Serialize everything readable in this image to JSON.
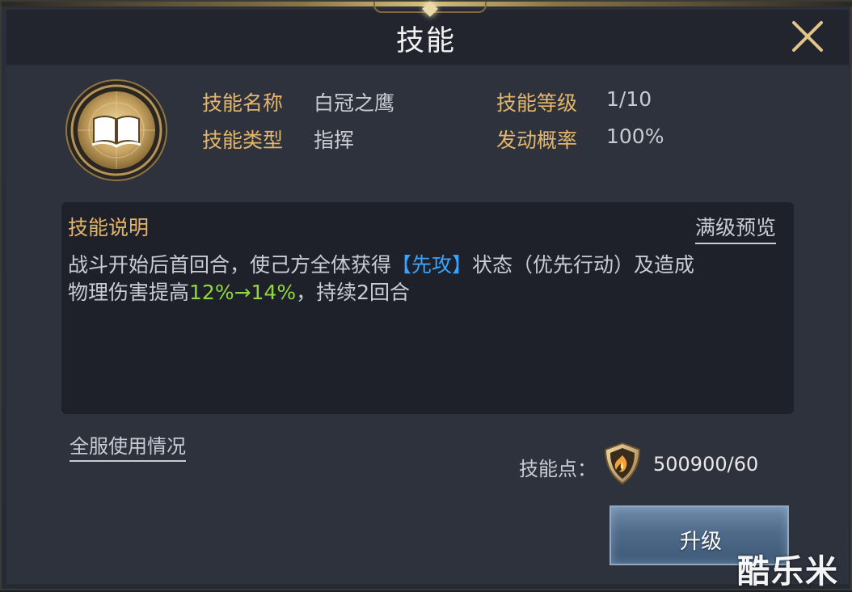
{
  "header": {
    "title": "技能"
  },
  "skill": {
    "name_label": "技能名称",
    "name_value": "白冠之鹰",
    "level_label": "技能等级",
    "level_value": "1/10",
    "type_label": "技能类型",
    "type_value": "指挥",
    "rate_label": "发动概率",
    "rate_value": "100%",
    "icon": "book-icon"
  },
  "description": {
    "title": "技能说明",
    "preview_link": "满级预览",
    "line1_part1": "战斗开始后首回合，使己方全体获得",
    "line1_highlight": "【先攻】",
    "line1_part2": "状态（优先行动）及造成",
    "line2_part1": "物理伤害提高",
    "line2_highlight": "12%→14%",
    "line2_part2": "，持续2回合"
  },
  "footer": {
    "usage_link": "全服使用情况",
    "points_label": "技能点：",
    "points_value": "500900/60",
    "points_icon": "flame-shield-icon",
    "upgrade_label": "升级"
  },
  "watermark": "酷乐米",
  "colors": {
    "label_gold": "#e3b66a",
    "text_gray": "#c9ccd3",
    "highlight_blue": "#3aa3ff",
    "highlight_green": "#8fd83d",
    "button_blue": "#4f6b8a"
  }
}
